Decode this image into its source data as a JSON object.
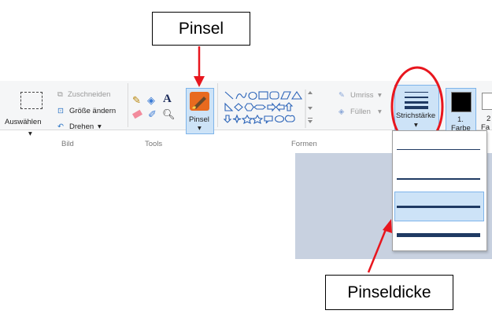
{
  "callouts": {
    "pinsel": "Pinsel",
    "pinseldicke": "Pinseldicke"
  },
  "ribbon": {
    "groups": {
      "bild": "Bild",
      "tools": "Tools",
      "formen": "Formen"
    },
    "auswaehlen": "Auswählen",
    "zuschneiden": "Zuschneiden",
    "groesse_aendern": "Größe ändern",
    "drehen": "Drehen",
    "pinsel": "Pinsel",
    "umriss": "Umriss",
    "fuellen": "Füllen",
    "strichstaerke": "Strichstärke",
    "farbe1_line1": "1.",
    "farbe1_line2": "Farbe",
    "farbe2_partial_line1": "2",
    "farbe2_partial_line2": "Fa"
  },
  "colors": {
    "farbe1": "#000000",
    "highlight": "#cde3f7",
    "accent": "#e8161e"
  }
}
